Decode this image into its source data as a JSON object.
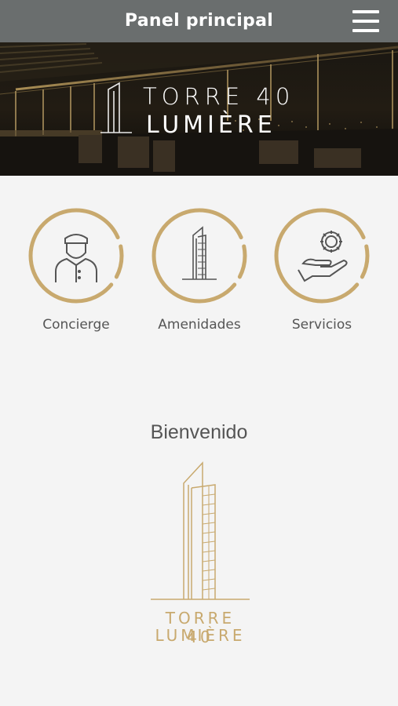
{
  "header": {
    "title": "Panel principal",
    "menu_icon": "hamburger-menu-icon"
  },
  "hero": {
    "brand_line1": "TORRE 40",
    "brand_line2": "LUMIÈRE"
  },
  "features": [
    {
      "label": "Concierge",
      "icon": "concierge-person-icon"
    },
    {
      "label": "Amenidades",
      "icon": "tower-building-icon"
    },
    {
      "label": "Servicios",
      "icon": "gear-hand-icon"
    }
  ],
  "welcome": {
    "text": "Bienvenido"
  },
  "logo": {
    "line1": "TORRE 40",
    "line2": "LUMIÈRE"
  },
  "colors": {
    "topbar": "#6a6e6e",
    "gold": "#c8a96e",
    "background": "#f4f4f4"
  }
}
